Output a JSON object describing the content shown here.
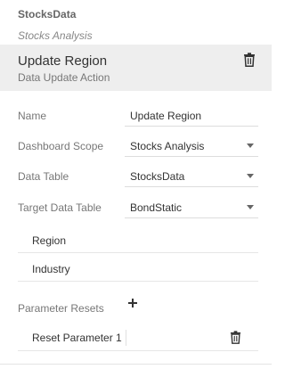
{
  "source": {
    "name": "StocksData",
    "subtitle": "Stocks Analysis"
  },
  "action": {
    "title": "Update Region",
    "type": "Data Update Action"
  },
  "form": {
    "name": {
      "label": "Name",
      "value": "Update Region"
    },
    "dashboard_scope": {
      "label": "Dashboard Scope",
      "value": "Stocks Analysis"
    },
    "data_table": {
      "label": "Data Table",
      "value": "StocksData"
    },
    "target_data_table": {
      "label": "Target Data Table",
      "value": "BondStatic"
    }
  },
  "columns": [
    "Region",
    "Industry"
  ],
  "parameter_resets": {
    "label": "Parameter Resets",
    "items": [
      "Reset Parameter 1"
    ]
  },
  "icons": {
    "delete": "trash-icon",
    "add": "plus-icon",
    "dropdown": "caret-down-icon"
  },
  "colors": {
    "header_bg": "#eeeeee",
    "label": "#777777",
    "text": "#333333"
  }
}
